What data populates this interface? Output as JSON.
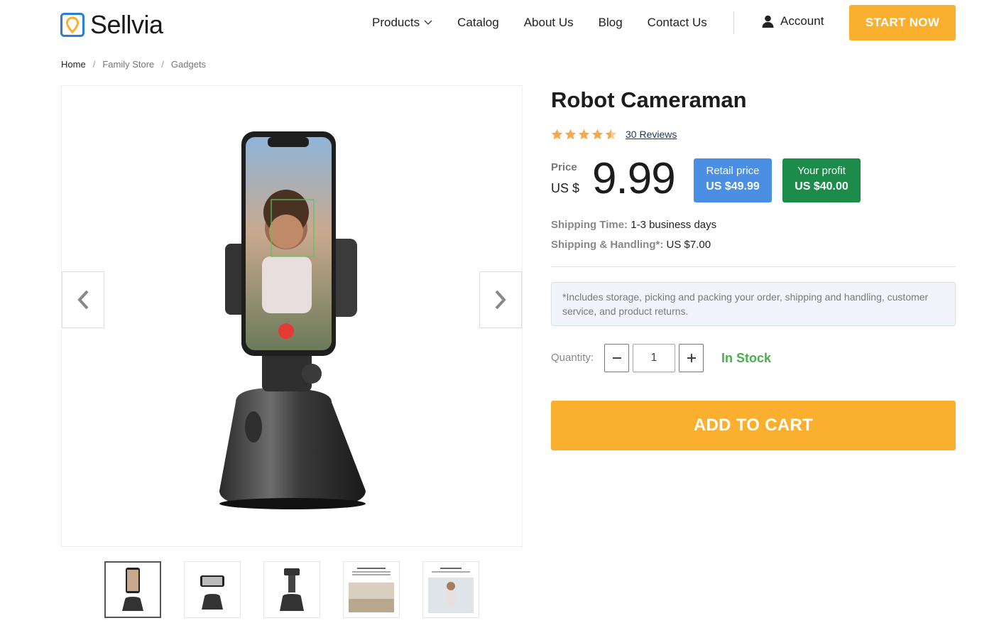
{
  "brand": {
    "name": "Sellvia"
  },
  "nav": {
    "products": "Products",
    "catalog": "Catalog",
    "about": "About Us",
    "blog": "Blog",
    "contact": "Contact Us",
    "account": "Account",
    "cta": "START NOW"
  },
  "breadcrumb": [
    "Home",
    "Family Store",
    "Gadgets"
  ],
  "product": {
    "title": "Robot Cameraman",
    "rating": 4.5,
    "reviews": "30 Reviews",
    "price_label": "Price",
    "currency": "US $",
    "price": "9.99",
    "retail_label": "Retail price",
    "retail_value": "US $49.99",
    "profit_label": "Your profit",
    "profit_value": "US $40.00",
    "shipping_time_label": "Shipping Time:",
    "shipping_time_value": "1-3 business days",
    "shipping_handling_label": "Shipping & Handling*:",
    "shipping_handling_value": "US $7.00",
    "note": "*Includes storage, picking and packing your order, shipping and handling, customer service, and product returns.",
    "quantity_label": "Quantity:",
    "quantity": "1",
    "stock": "In Stock",
    "add_to_cart": "ADD TO CART"
  },
  "icons": {
    "logo": "map-pin-logo-icon",
    "chevron": "chevron-down-icon",
    "account": "user-icon",
    "prev": "chevron-left-icon",
    "next": "chevron-right-icon",
    "minus": "minus-icon",
    "plus": "plus-icon",
    "star": "star-icon"
  },
  "colors": {
    "accent": "#fbaf2e",
    "retail_badge": "#4a8fe3",
    "profit_badge": "#1d8c4a",
    "in_stock": "#4cae4c",
    "star": "#f5a94a"
  },
  "gallery": {
    "thumb_count": 5,
    "active_index": 0
  }
}
